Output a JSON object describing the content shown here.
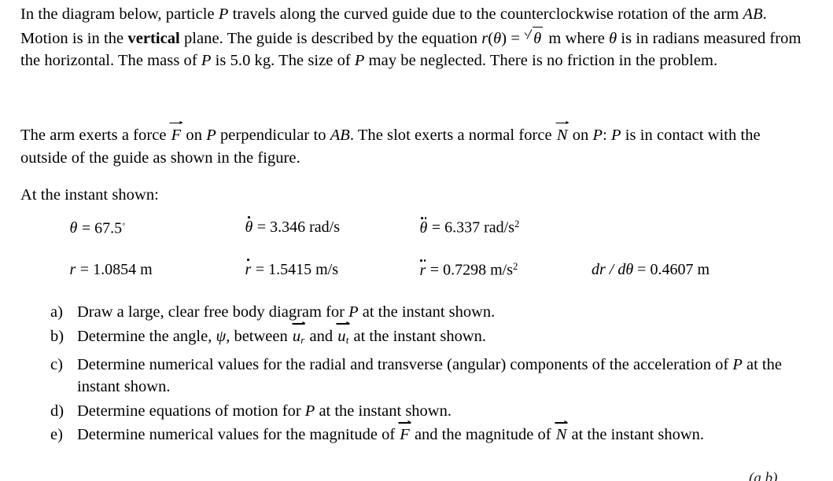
{
  "document": {
    "type": "physics-problem-statement",
    "background_color": "#ffffff",
    "text_color": "#000000"
  },
  "intro": {
    "seg1": "In the diagram below, particle ",
    "var_P1": "P",
    "seg2": " travels along the curved guide due to the counterclockwise rotation of the arm ",
    "var_AB": "AB",
    "seg3": ". Motion is in the ",
    "bold_vertical": "vertical",
    "seg4": " plane. The guide is described by the equation ",
    "eq_r": "r",
    "eq_open": "(",
    "eq_theta1": "θ",
    "eq_close": ")",
    "eq_equals": " = ",
    "eq_sqrt_radicand": "θ",
    "eq_unit": " m",
    "seg5": " where ",
    "theta_sym": "θ",
    "seg6": " is in radians measured from the horizontal. The mass of ",
    "var_P2": "P",
    "seg7": " is 5.0 kg. The size of ",
    "var_P3": "P",
    "seg8": " may be neglected. There is no friction in the problem."
  },
  "forces": {
    "seg1": "The arm exerts a force ",
    "vec_F": "F",
    "seg2": " on ",
    "var_P1": "P",
    "seg3": " perpendicular to ",
    "var_AB": "AB",
    "seg4": ". The slot exerts a normal force ",
    "vec_N": "N",
    "seg5": " on ",
    "var_P2": "P",
    "seg6": ": ",
    "var_P3": "P",
    "seg7": " is in contact with the outside of the guide as shown in the figure."
  },
  "instant_label": "At the instant shown:",
  "data_rows": [
    {
      "cells": [
        {
          "symbol": "θ",
          "dots": 0,
          "equals": " = ",
          "value": "67.5",
          "unit": "",
          "degree": true,
          "exponent": ""
        },
        {
          "symbol": "θ",
          "dots": 1,
          "equals": " = ",
          "value": "3.346",
          "unit": " rad/s",
          "degree": false,
          "exponent": ""
        },
        {
          "symbol": "θ",
          "dots": 2,
          "equals": " = ",
          "value": "6.337",
          "unit": " rad/s",
          "degree": false,
          "exponent": "2"
        }
      ]
    },
    {
      "cells": [
        {
          "symbol": "r",
          "dots": 0,
          "equals": " = ",
          "value": "1.0854",
          "unit": " m",
          "degree": false,
          "exponent": ""
        },
        {
          "symbol": "r",
          "dots": 1,
          "equals": " = ",
          "value": "1.5415",
          "unit": " m/s",
          "degree": false,
          "exponent": ""
        },
        {
          "symbol": "r",
          "dots": 2,
          "equals": " = ",
          "value": "0.7298",
          "unit": " m/s",
          "degree": false,
          "exponent": "2"
        },
        {
          "symbol": "dr",
          "dots": 0,
          "equals": " = ",
          "value": "0.4607",
          "unit": " m",
          "degree": false,
          "exponent": "",
          "fraction_label": "dr / dθ"
        }
      ]
    }
  ],
  "questions": [
    {
      "marker": "a)",
      "parts": [
        {
          "kind": "text",
          "text": "Draw a large, clear free body diagram for "
        },
        {
          "kind": "italic",
          "text": "P"
        },
        {
          "kind": "text",
          "text": " at the instant shown."
        }
      ]
    },
    {
      "marker": "b)",
      "parts": [
        {
          "kind": "text",
          "text": "Determine the angle, "
        },
        {
          "kind": "italic",
          "text": "ψ"
        },
        {
          "kind": "text",
          "text": ", between "
        },
        {
          "kind": "vector",
          "text": "u",
          "sub": "r"
        },
        {
          "kind": "text",
          "text": " and "
        },
        {
          "kind": "vector",
          "text": "u",
          "sub": "t"
        },
        {
          "kind": "text",
          "text": " at the instant shown."
        }
      ]
    },
    {
      "marker": "c)",
      "parts": [
        {
          "kind": "text",
          "text": "Determine numerical values for the radial and transverse (angular) components of the acceleration of "
        },
        {
          "kind": "italic",
          "text": "P"
        },
        {
          "kind": "text",
          "text": " at the instant shown."
        }
      ]
    },
    {
      "marker": "d)",
      "parts": [
        {
          "kind": "text",
          "text": "Determine equations of motion for "
        },
        {
          "kind": "italic",
          "text": "P"
        },
        {
          "kind": "text",
          "text": " at the instant shown."
        }
      ]
    },
    {
      "marker": "e)",
      "parts": [
        {
          "kind": "text",
          "text": "Determine numerical values for the magnitude of "
        },
        {
          "kind": "vector",
          "text": "F",
          "sub": ""
        },
        {
          "kind": "text",
          "text": " and the magnitude of "
        },
        {
          "kind": "vector",
          "text": "N",
          "sub": ""
        },
        {
          "kind": "text",
          "text": " at the instant shown."
        }
      ]
    }
  ],
  "clipped_bottom_text": "(a  b)"
}
